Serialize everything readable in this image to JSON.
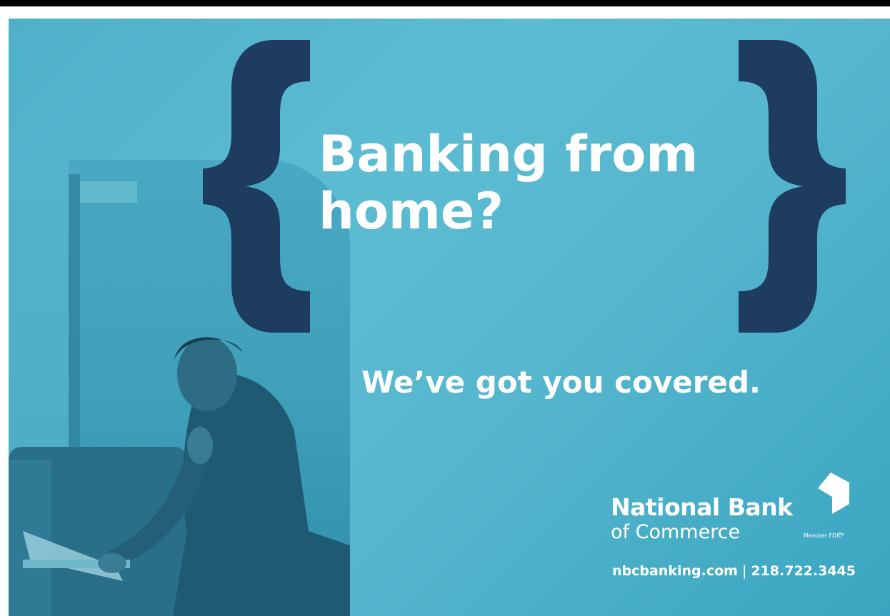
{
  "ad": {
    "headline": "Banking from home?",
    "subhead": "We’ve got you covered.",
    "bank_name_line1": "National Bank",
    "bank_name_line2": "of Commerce",
    "trademark": "TM",
    "member_fdic": "Member FDIC",
    "website": "nbcbanking.com",
    "separator": "|",
    "phone": "218.722.3445"
  },
  "icons": {
    "left_brace": "left-curly-brace-icon",
    "right_brace": "right-curly-brace-icon",
    "logo_mark": "bank-cube-logo-icon"
  },
  "colors": {
    "background": "#55b6cd",
    "brace": "#1e3c60",
    "text": "#ffffff"
  }
}
